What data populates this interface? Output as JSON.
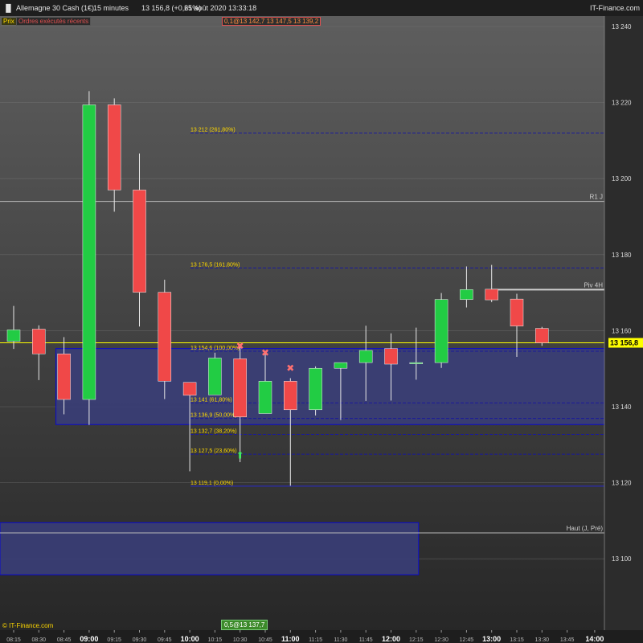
{
  "header": {
    "title": "Allemagne 30 Cash (1€)",
    "timeframe": "15 minutes",
    "last_change": "13 156,8 (+0,61%)",
    "datetime": "25 août 2020 13:33:18",
    "brand": "IT-Finance.com"
  },
  "toolbar": {
    "price_tab": "Prix",
    "orders_tab": "Ordres exécutés récents"
  },
  "top_tag": {
    "label": "0,1@13 142,7",
    "vals": [
      "13 147,5",
      "13 139,2"
    ]
  },
  "bottom_tag": "0,5@13 137,7",
  "footer_brand": "© IT-Finance.com",
  "current_price_label": "13 156,8",
  "colors": {
    "background": "#2b2b2b",
    "bull": "#22cc44",
    "bear": "#f04848",
    "zone": "#3a3e78",
    "fib": "#ffd800",
    "fib_line": "#1a1a9a",
    "current_line": "#ffff00"
  },
  "chart_data": {
    "type": "candlestick",
    "y_ticks": [
      13100,
      13120,
      13140,
      13160,
      13180,
      13200,
      13220,
      13240
    ],
    "y_tick_labels": [
      "13 100",
      "13 120",
      "13 140",
      "13 160",
      "13 180",
      "13 200",
      "13 220",
      "13 240"
    ],
    "ylim": [
      13085,
      13242
    ],
    "x_labels": [
      {
        "t": "08:15",
        "bold": false
      },
      {
        "t": "08:30",
        "bold": false
      },
      {
        "t": "08:45",
        "bold": false
      },
      {
        "t": "09:00",
        "bold": true
      },
      {
        "t": "09:15",
        "bold": false
      },
      {
        "t": "09:30",
        "bold": false
      },
      {
        "t": "09:45",
        "bold": false
      },
      {
        "t": "10:00",
        "bold": true
      },
      {
        "t": "10:15",
        "bold": false
      },
      {
        "t": "10:30",
        "bold": false
      },
      {
        "t": "10:45",
        "bold": false
      },
      {
        "t": "11:00",
        "bold": true
      },
      {
        "t": "11:15",
        "bold": false
      },
      {
        "t": "11:30",
        "bold": false
      },
      {
        "t": "11:45",
        "bold": false
      },
      {
        "t": "12:00",
        "bold": true
      },
      {
        "t": "12:15",
        "bold": false
      },
      {
        "t": "12:30",
        "bold": false
      },
      {
        "t": "12:45",
        "bold": false
      },
      {
        "t": "13:00",
        "bold": true
      },
      {
        "t": "13:15",
        "bold": false
      },
      {
        "t": "13:30",
        "bold": false
      },
      {
        "t": "13:45",
        "bold": false
      },
      {
        "t": "14:00",
        "bold": true
      }
    ],
    "candles": [
      {
        "t": "08:15",
        "o": 13157.2,
        "h": 13166.5,
        "l": 13155.2,
        "c": 13160.2
      },
      {
        "t": "08:30",
        "o": 13160.4,
        "h": 13161.4,
        "l": 13147.0,
        "c": 13153.9
      },
      {
        "t": "08:45",
        "o": 13153.9,
        "h": 13158.3,
        "l": 13138.0,
        "c": 13141.9
      },
      {
        "t": "09:00",
        "o": 13141.9,
        "h": 13223.0,
        "l": 13135.2,
        "c": 13219.4
      },
      {
        "t": "09:15",
        "o": 13219.4,
        "h": 13221.1,
        "l": 13191.3,
        "c": 13197.0
      },
      {
        "t": "09:30",
        "o": 13197.0,
        "h": 13206.6,
        "l": 13161.1,
        "c": 13170.1
      },
      {
        "t": "09:45",
        "o": 13170.1,
        "h": 13173.4,
        "l": 13142.0,
        "c": 13146.7
      },
      {
        "t": "10:00",
        "o": 13146.4,
        "h": 13146.4,
        "l": 13123.0,
        "c": 13143.0
      },
      {
        "t": "10:15",
        "o": 13143.1,
        "h": 13154.2,
        "l": 13143.1,
        "c": 13152.8
      },
      {
        "t": "10:30",
        "o": 13152.6,
        "h": 13155.8,
        "l": 13125.4,
        "c": 13137.3
      },
      {
        "t": "10:45",
        "o": 13138.2,
        "h": 13154.2,
        "l": 13138.2,
        "c": 13146.7
      },
      {
        "t": "11:00",
        "o": 13146.7,
        "h": 13147.5,
        "l": 13119.2,
        "c": 13139.2
      },
      {
        "t": "11:15",
        "o": 13139.2,
        "h": 13150.6,
        "l": 13137.7,
        "c": 13150.1
      },
      {
        "t": "11:30",
        "o": 13150.1,
        "h": 13150.8,
        "l": 13136.5,
        "c": 13151.6
      },
      {
        "t": "11:45",
        "o": 13151.6,
        "h": 13161.3,
        "l": 13141.5,
        "c": 13154.8
      },
      {
        "t": "12:00",
        "o": 13155.3,
        "h": 13159.3,
        "l": 13141.6,
        "c": 13151.2
      },
      {
        "t": "12:15",
        "o": 13151.6,
        "h": 13160.8,
        "l": 13147.1,
        "c": 13151.6
      },
      {
        "t": "12:30",
        "o": 13151.6,
        "h": 13169.9,
        "l": 13150.2,
        "c": 13168.2
      },
      {
        "t": "12:45",
        "o": 13168.2,
        "h": 13176.9,
        "l": 13166.1,
        "c": 13170.8
      },
      {
        "t": "13:00",
        "o": 13170.9,
        "h": 13177.3,
        "l": 13167.5,
        "c": 13168.1
      },
      {
        "t": "13:15",
        "o": 13168.3,
        "h": 13169.7,
        "l": 13153.1,
        "c": 13161.2
      },
      {
        "t": "13:30",
        "o": 13160.6,
        "h": 13161.0,
        "l": 13156.0,
        "c": 13156.8
      }
    ],
    "fib_levels": [
      {
        "price": 13212.0,
        "label": "13 212 (261,80%)"
      },
      {
        "price": 13176.5,
        "label": "13 176,5 (161,80%)"
      },
      {
        "price": 13154.6,
        "label": "13 154,6 (100,00%)"
      },
      {
        "price": 13141.0,
        "label": "13 141 (61,80%)"
      },
      {
        "price": 13136.9,
        "label": "13 136,9 (50,00%)"
      },
      {
        "price": 13132.7,
        "label": "13 132,7 (38,20%)"
      },
      {
        "price": 13127.5,
        "label": "13 127,5 (23,60%)"
      },
      {
        "price": 13119.1,
        "label": "13 119,1 (0,00%)"
      }
    ],
    "pivots": [
      {
        "label": "R1 J",
        "price": 13194.0,
        "from": "08:15",
        "color": "#b8b8b8"
      },
      {
        "label": "Piv 4H",
        "price": 13170.8,
        "from": "13:00",
        "color": "#d0d0d0"
      },
      {
        "label": "Haut (J, Pré)",
        "price": 13106.8,
        "from": "08:15",
        "color": "#b8b8b8"
      }
    ],
    "zones": [
      {
        "from": "08:45",
        "price_top": 13155.3,
        "price_bottom": 13135.3
      },
      {
        "from": "08:15",
        "price_top": 13109.5,
        "price_bottom": 13095.8,
        "until": "12:15"
      }
    ],
    "current_price": 13156.8,
    "markers": [
      {
        "t": "10:30",
        "price": 13155.8,
        "glyph": "✖",
        "color": "#ff7070"
      },
      {
        "t": "10:45",
        "price": 13154.0,
        "glyph": "✖",
        "color": "#ff7070"
      },
      {
        "t": "11:00",
        "price": 13150.0,
        "glyph": "✖",
        "color": "#ff7070"
      },
      {
        "t": "10:30",
        "price": 13127.0,
        "glyph": "⬆",
        "color": "#40ee60"
      }
    ]
  }
}
